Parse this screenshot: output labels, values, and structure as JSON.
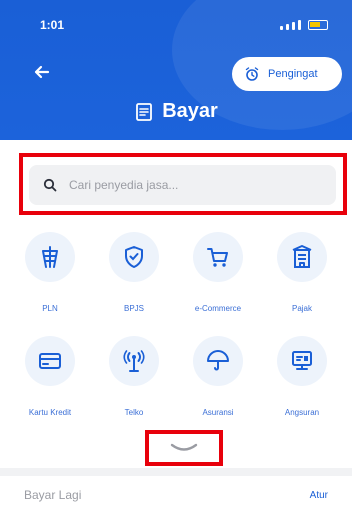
{
  "status_bar": {
    "time": "1:01"
  },
  "header": {
    "pengingat_label": "Pengingat",
    "title": "Bayar"
  },
  "search": {
    "placeholder": "Cari penyedia jasa..."
  },
  "categories": [
    {
      "label": "PLN",
      "icon": "pln-icon"
    },
    {
      "label": "BPJS",
      "icon": "shield-icon"
    },
    {
      "label": "e-Commerce",
      "icon": "cart-icon"
    },
    {
      "label": "Pajak",
      "icon": "building-icon"
    },
    {
      "label": "Kartu Kredit",
      "icon": "card-icon"
    },
    {
      "label": "Telko",
      "icon": "antenna-icon"
    },
    {
      "label": "Asuransi",
      "icon": "umbrella-icon"
    },
    {
      "label": "Angsuran",
      "icon": "installment-icon"
    }
  ],
  "footer": {
    "bayar_lagi": "Bayar Lagi",
    "atur": "Atur"
  },
  "colors": {
    "brand_blue": "#1a5fd6",
    "highlight_red": "#e8000b",
    "icon_bg": "#edf3fb"
  }
}
